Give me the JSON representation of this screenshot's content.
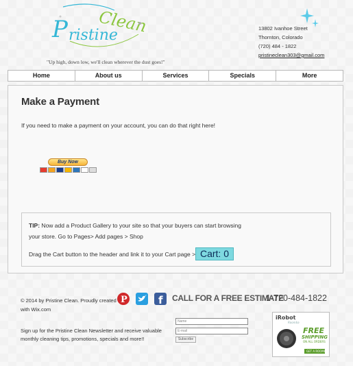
{
  "header": {
    "logo": {
      "word1": "Pristine",
      "word2": "Clean",
      "color1": "#35b7d6",
      "color2": "#8cc63f"
    },
    "tagline": "\"Up high, down low, we'll clean wherever the dust goes!\"",
    "address": [
      "13802 Ivanhoe Street",
      "Thornton, Colorado",
      "(720) 484 - 1822"
    ],
    "email": "pristineclean303@gmail.com"
  },
  "nav": {
    "items": [
      "Home",
      "About us",
      "Services",
      "Specials",
      "More"
    ]
  },
  "main": {
    "title": "Make a Payment",
    "intro": "If you need to make a payment on your account, you can do that right here!",
    "paypal_button": "Buy Now"
  },
  "tip": {
    "label": "TIP:",
    "line1": " Now add a Product Gallery to your site so that your buyers can start browsing",
    "line2": "your store. Go to Pages> Add pages > Shop",
    "line3": "Drag the Cart button to the header and link it to your Cart page >>",
    "cart_label": "Cart: 0"
  },
  "footer": {
    "copyright1": "© 2014 by Pristine Clean. Proudly created",
    "copyright2": "with Wix.com",
    "cta": "CALL FOR A FREE ESTIMATE",
    "phone": "1-720-484-1822",
    "newsletter1": "Sign up for the Pristine Clean Newsletter and receive valuable",
    "newsletter2": "monthly cleaning tips, promotions, specials and more!!",
    "name_placeholder": "Name",
    "email_placeholder": "E-mail",
    "subscribe": "Subscribe",
    "ad": {
      "brand": "iRobot",
      "tagline": "Roomba",
      "headline": "FREE",
      "line2": "SHIPPING",
      "line3": "ON ALL ORDERS",
      "button": "GET A ROOMBA"
    },
    "social": [
      "pinterest-icon",
      "twitter-icon",
      "facebook-icon"
    ]
  }
}
